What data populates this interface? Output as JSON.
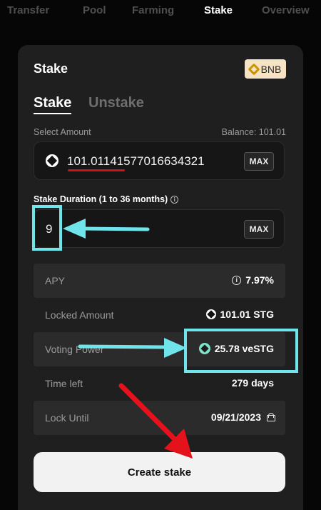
{
  "nav": {
    "tabs": [
      {
        "label": "Transfer",
        "active": false
      },
      {
        "label": "Pool",
        "active": false
      },
      {
        "label": "Farming",
        "active": false
      },
      {
        "label": "Stake",
        "active": true
      },
      {
        "label": "Overview",
        "active": false
      }
    ]
  },
  "card": {
    "title": "Stake",
    "chain": {
      "label": "BNB",
      "icon": "bnb-icon"
    },
    "mode_tabs": {
      "stake": "Stake",
      "unstake": "Unstake"
    },
    "amount": {
      "label": "Select Amount",
      "balance": "Balance: 101.01",
      "value": "101.01141577016634321",
      "token_icon": "stg-icon",
      "max_label": "MAX"
    },
    "duration": {
      "label": "Stake Duration (1 to 36 months)",
      "value": "9",
      "max_label": "MAX"
    },
    "details": {
      "apy": {
        "label": "APY",
        "value": "7.97%"
      },
      "locked_amount": {
        "label": "Locked Amount",
        "value": "101.01 STG"
      },
      "voting_power": {
        "label": "Voting Power",
        "value": "25.78 veSTG"
      },
      "time_left": {
        "label": "Time left",
        "value": "279 days"
      },
      "lock_until": {
        "label": "Lock Until",
        "value": "09/21/2023"
      }
    },
    "submit_label": "Create stake"
  },
  "colors": {
    "background": "#060606",
    "card": "#1f1f1f",
    "annotation_cyan": "#6fe4ea",
    "annotation_red": "#e4121b",
    "vestg_accent": "#7fe3c5"
  }
}
